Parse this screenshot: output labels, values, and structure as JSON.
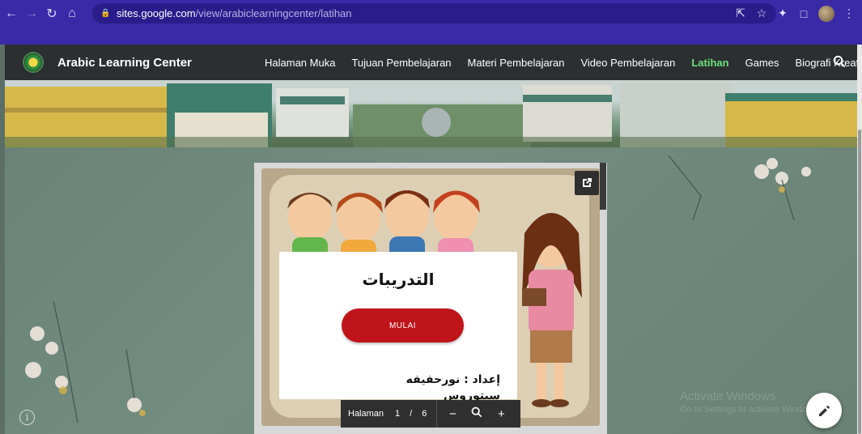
{
  "browser": {
    "url_host": "sites.google.com",
    "url_path": "/view/arabiclearningcenter/latihan",
    "icons": [
      "back-icon",
      "forward-icon",
      "reload-icon",
      "home-icon",
      "lock-icon",
      "share-icon",
      "star-icon",
      "extensions-icon",
      "sidebar-icon",
      "profile-avatar",
      "menu-icon"
    ]
  },
  "site": {
    "title": "Arabic Learning Center",
    "nav": [
      {
        "label": "Halaman Muka"
      },
      {
        "label": "Tujuan Pembelajaran"
      },
      {
        "label": "Materi Pembelajaran"
      },
      {
        "label": "Video Pembelajaran"
      },
      {
        "label": "Latihan",
        "active": true
      },
      {
        "label": "Games"
      },
      {
        "label": "Biografi Kreator"
      }
    ],
    "accent_color": "#6ee07a"
  },
  "slide": {
    "title": "التدريبات",
    "button_label": "MULAI",
    "author_line1": "إعداد : نورحفيفه",
    "author_line2": "سيتوروس"
  },
  "viewer": {
    "page_label": "Halaman",
    "current_page": "1",
    "page_sep": "/",
    "total_pages": "6"
  },
  "watermark": {
    "line1": "Activate Windows",
    "line2": "Go to Settings to activate Windows."
  }
}
